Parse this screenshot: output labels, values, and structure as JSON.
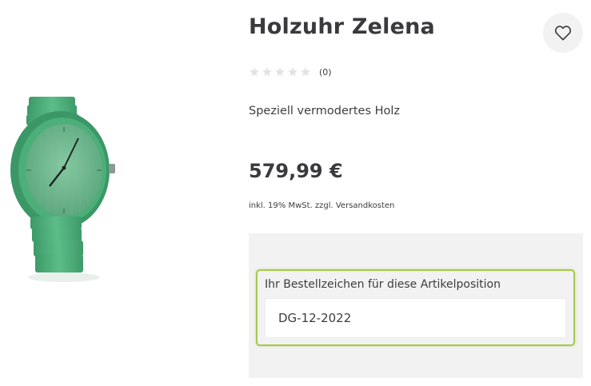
{
  "product": {
    "title": "Holzuhr Zelena",
    "image_icon": "green-wooden-watch",
    "rating": {
      "value": 0,
      "max": 5,
      "count_label": "(0)"
    },
    "description": "Speziell vermodertes Holz",
    "price": "579,99 €",
    "tax_note": "inkl. 19% MwSt. zzgl. Versandkosten"
  },
  "wishlist": {
    "icon": "heart-icon"
  },
  "order_reference": {
    "label": "Ihr Bestellzeichen für diese Artikelposition",
    "value": "DG-12-2022"
  },
  "colors": {
    "accent_border": "#a6c94d",
    "panel_bg": "#f2f2f2",
    "text": "#3d3d40",
    "watch_green": "#4fb67f"
  }
}
